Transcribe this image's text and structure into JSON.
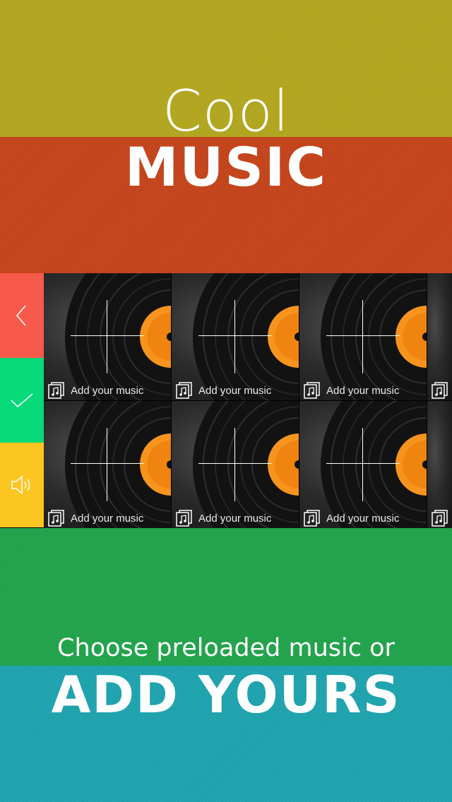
{
  "header": {
    "line1": "Cool",
    "line2": "MUSIC"
  },
  "footer": {
    "line1": "Choose preloaded music or",
    "line2": "ADD YOURS"
  },
  "colors": {
    "olive": "#b1a51f",
    "red": "#c3431a",
    "green": "#21a24a",
    "teal": "#1ea2ad",
    "btn_back": "#f75a4a",
    "btn_confirm": "#08d979",
    "btn_volume": "#fcc622",
    "record_label": "#f7941d"
  },
  "side_controls": [
    {
      "name": "back",
      "icon": "chevron-left-icon"
    },
    {
      "name": "confirm",
      "icon": "checkmark-icon"
    },
    {
      "name": "volume",
      "icon": "speaker-icon"
    }
  ],
  "tiles": {
    "caption": "Add your music",
    "icon": "music-note-icon"
  }
}
